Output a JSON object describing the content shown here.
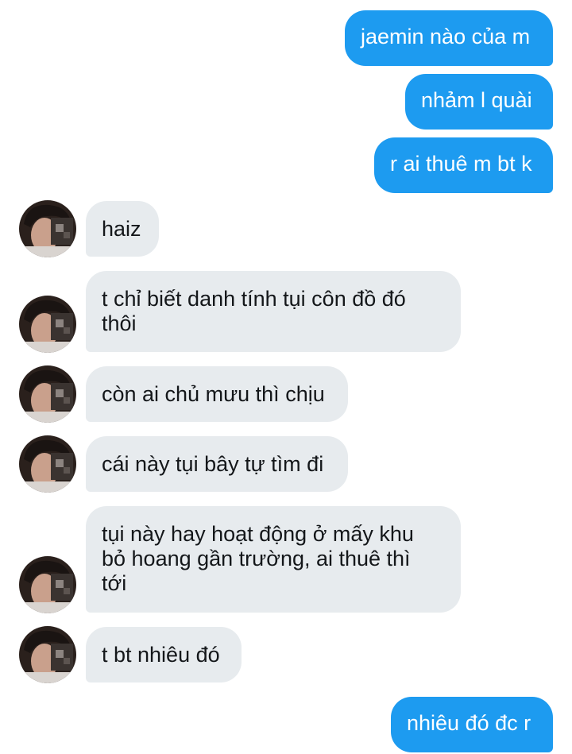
{
  "conversation": {
    "messages": [
      {
        "id": "m1",
        "direction": "sent",
        "lines": [
          "jaemin nào của m"
        ]
      },
      {
        "id": "m2",
        "direction": "sent",
        "lines": [
          "nhảm l quài"
        ]
      },
      {
        "id": "m3",
        "direction": "sent",
        "lines": [
          "r ai thuê m bt k"
        ]
      },
      {
        "id": "m4",
        "direction": "received",
        "lines": [
          "haiz"
        ]
      },
      {
        "id": "m5",
        "direction": "received",
        "lines": [
          "t chỉ biết danh tính tụi côn đồ đó",
          "thôi"
        ]
      },
      {
        "id": "m6",
        "direction": "received",
        "lines": [
          "còn ai chủ mưu thì chịu"
        ]
      },
      {
        "id": "m7",
        "direction": "received",
        "lines": [
          "cái này tụi bây tự tìm đi"
        ]
      },
      {
        "id": "m8",
        "direction": "received",
        "lines": [
          "tụi này hay hoạt động ở mấy khu",
          "bỏ hoang gần trường, ai thuê thì",
          "tới"
        ]
      },
      {
        "id": "m9",
        "direction": "received",
        "lines": [
          "t bt nhiêu đó"
        ]
      },
      {
        "id": "m10",
        "direction": "sent",
        "lines": [
          "nhiêu đó đc r"
        ]
      }
    ]
  },
  "theme": {
    "sent_bubble_color": "#1d9bf0",
    "received_bubble_color": "#e7ebee",
    "background_color": "#ffffff"
  },
  "icons": {
    "avatar": "contact-avatar"
  }
}
